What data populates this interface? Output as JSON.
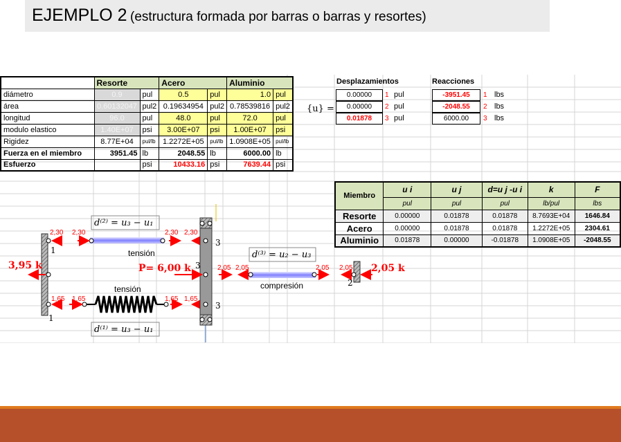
{
  "title": {
    "main": "EJEMPLO 2",
    "sub": "(estructura formada por barras o barras y resortes)"
  },
  "props_table": {
    "headers": [
      "Resorte",
      "Acero",
      "Aluminio"
    ],
    "rows": [
      {
        "label": "diámetro",
        "c1": "0.9",
        "u1": "pul",
        "c2": "0.5",
        "u2": "pul",
        "c3": "1.0",
        "u3": "pul"
      },
      {
        "label": "área",
        "c1": "0.60132047",
        "u1": "pul2",
        "c2": "0.19634954",
        "u2": "pul2",
        "c3": "0.78539816",
        "u3": "pul2"
      },
      {
        "label": "longitud",
        "c1": "96.0",
        "u1": "pul",
        "c2": "48.0",
        "u2": "pul",
        "c3": "72.0",
        "u3": "pul"
      },
      {
        "label": "modulo elastico",
        "c1": "1.40E+07",
        "u1": "psi",
        "c2": "3.00E+07",
        "u2": "psi",
        "c3": "1.00E+07",
        "u3": "psi"
      },
      {
        "label": "Rigidez",
        "c1": "8.77E+04",
        "u1": "pul/lb",
        "c2": "1.2272E+05",
        "u2": "pul/lb",
        "c3": "1.0908E+05",
        "u3": "pul/lb"
      },
      {
        "label": "Fuerza en el miembro",
        "c1": "3951.45",
        "u1": "lb",
        "c2": "2048.55",
        "u2": "lb",
        "c3": "6000.00",
        "u3": "lb"
      },
      {
        "label": "Esfuerzo",
        "c1": "",
        "u1": "psi",
        "c2": "10433.16",
        "u2": "psi",
        "c3": "7639.44",
        "u3": "psi"
      }
    ]
  },
  "displacements": {
    "header": "Desplazamientos",
    "symbol": "{u} =",
    "values": [
      "0.00000",
      "0.00000",
      "0.01878"
    ],
    "indices": [
      "1",
      "2",
      "3"
    ],
    "unit": "pul"
  },
  "reactions": {
    "header": "Reacciones",
    "values": [
      "-3951.45",
      "-2048.55",
      "6000.00"
    ],
    "indices": [
      "1",
      "2",
      "3"
    ],
    "unit": "lbs"
  },
  "results_table": {
    "headers": [
      "Miembro",
      "u i",
      "u j",
      "d=u j -u i",
      "k",
      "F"
    ],
    "units": [
      "pul",
      "pul",
      "pul",
      "lb/pul",
      "lbs"
    ],
    "rows": [
      {
        "name": "Resorte",
        "ui": "0.00000",
        "uj": "0.01878",
        "d": "0.01878",
        "k": "8.7693E+04",
        "f": "1646.84"
      },
      {
        "name": "Acero",
        "ui": "0.00000",
        "uj": "0.01878",
        "d": "0.01878",
        "k": "1.2272E+05",
        "f": "2304.61"
      },
      {
        "name": "Aluminio",
        "ui": "0.01878",
        "uj": "0.00000",
        "d": "-0.01878",
        "k": "1.0908E+05",
        "f": "-2048.55"
      }
    ]
  },
  "diagram": {
    "eq2": "d⁽²⁾ = u₃ − u₁",
    "eq1": "d⁽¹⁾ = u₃ − u₁",
    "eq3": "d⁽³⁾ = u₂ − u₃",
    "tension_top": "tensión",
    "tension_bottom": "tensión",
    "compression": "compresión",
    "load": "P= 6,00 k",
    "reaction_left": "3,95 k",
    "reaction_right": "2,05 k",
    "f_top_left_a": "2,30",
    "f_top_left_b": "2,30",
    "f_top_right_a": "2,30",
    "f_top_right_b": "2,30",
    "f_bot_left_a": "1,65",
    "f_bot_left_b": "1,65",
    "f_bot_right_a": "1,65",
    "f_bot_right_b": "1,65",
    "f_mid_a": "2,05",
    "f_mid_b": "2,05",
    "f_mid_c": "2,05",
    "f_mid_d": "2,05",
    "node1_top": "1",
    "node1_bot": "1",
    "node3_top": "3",
    "node3_mid": "3",
    "node3_bot": "3",
    "node2": "2"
  },
  "colors": {
    "header_green": "#d8e4bc",
    "input_yellow": "#ffff99",
    "highlight_red": "#ff0000",
    "footer_brown": "#b5502a",
    "footer_orange": "#e07a1f"
  }
}
